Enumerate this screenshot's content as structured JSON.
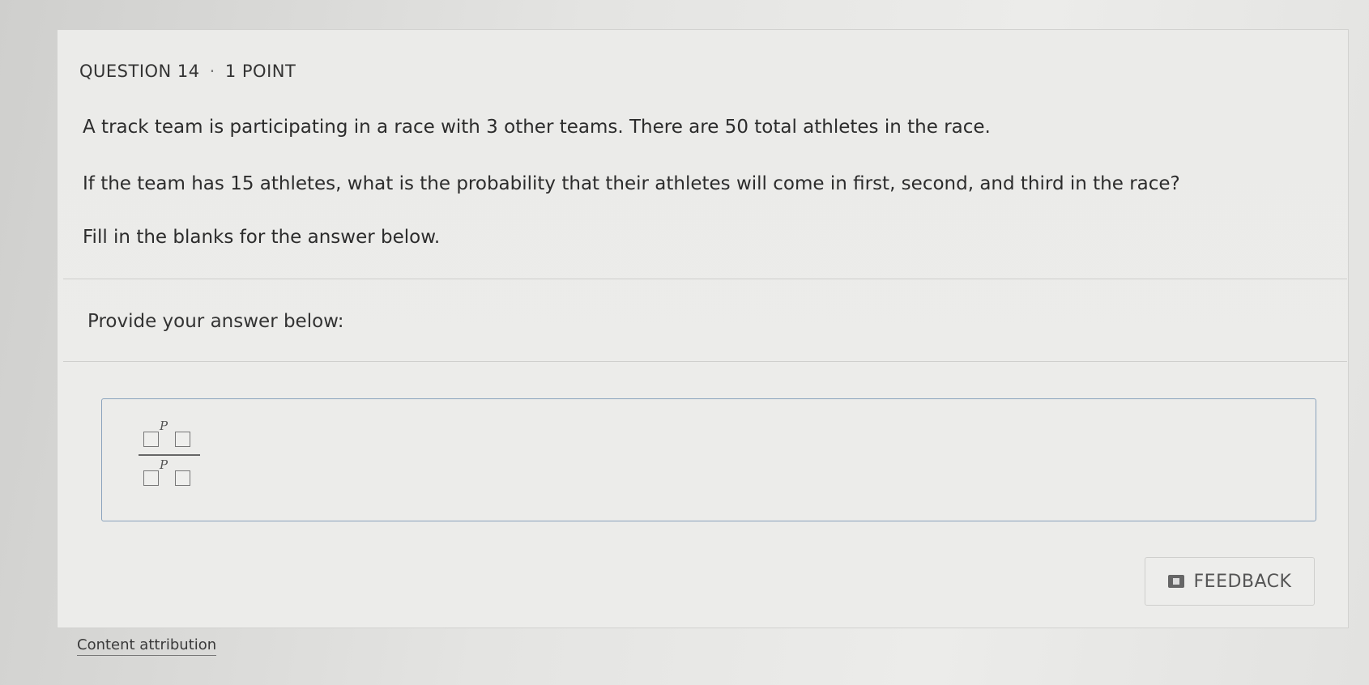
{
  "question": {
    "number_label": "QUESTION 14",
    "separator": "·",
    "points_label": "1 POINT",
    "stem_lines": [
      "A track team is participating in a race with 3 other teams. There are 50 total athletes in the race.",
      "If the team has 15 athletes, what is the probability that their athletes will come in first, second, and third in the race?",
      "Fill in the blanks for the answer below."
    ]
  },
  "answer": {
    "prompt": "Provide your answer below:",
    "numerator": {
      "letter": "P"
    },
    "denominator": {
      "letter": "P"
    }
  },
  "feedback": {
    "label": "FEEDBACK",
    "icon": "feedback-icon"
  },
  "footer": {
    "attribution_label": "Content attribution"
  }
}
